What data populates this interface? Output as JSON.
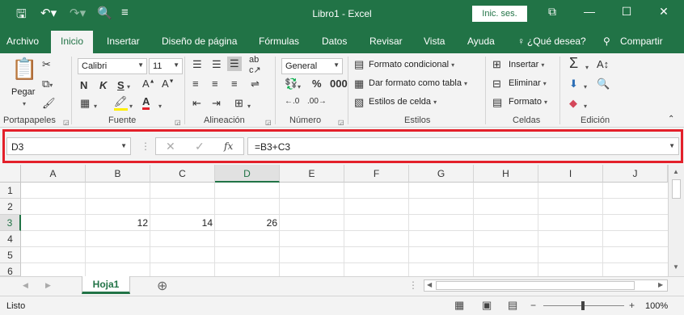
{
  "window": {
    "title": "Libro1 - Excel",
    "signin": "Inic. ses.",
    "colors": {
      "brand": "#217346",
      "highlight": "#e3202a"
    }
  },
  "tabs": [
    "Archivo",
    "Inicio",
    "Insertar",
    "Diseño de página",
    "Fórmulas",
    "Datos",
    "Revisar",
    "Vista",
    "Ayuda"
  ],
  "tell_me": "¿Qué desea?",
  "share": "Compartir",
  "ribbon": {
    "paste": "Pegar",
    "font_name": "Calibri",
    "font_size": "11",
    "bold": "N",
    "italic": "K",
    "underline": "S",
    "number_format": "General",
    "styles": {
      "conditional": "Formato condicional",
      "as_table": "Dar formato como tabla",
      "cell_styles": "Estilos de celda"
    },
    "cells": {
      "insert": "Insertar",
      "delete": "Eliminar",
      "format": "Formato"
    },
    "groups": [
      "Portapapeles",
      "Fuente",
      "Alineación",
      "Número",
      "Estilos",
      "Celdas",
      "Edición"
    ]
  },
  "formula_bar": {
    "name_box": "D3",
    "formula": "=B3+C3",
    "fx": "fx"
  },
  "grid": {
    "columns": [
      "A",
      "B",
      "C",
      "D",
      "E",
      "F",
      "G",
      "H",
      "I",
      "J"
    ],
    "rows": [
      "1",
      "2",
      "3",
      "4",
      "5",
      "6"
    ],
    "cells": {
      "B3": "12",
      "C3": "14",
      "D3": "26"
    }
  },
  "sheet": {
    "name": "Hoja1"
  },
  "status": {
    "ready": "Listo",
    "zoom": "100%"
  }
}
